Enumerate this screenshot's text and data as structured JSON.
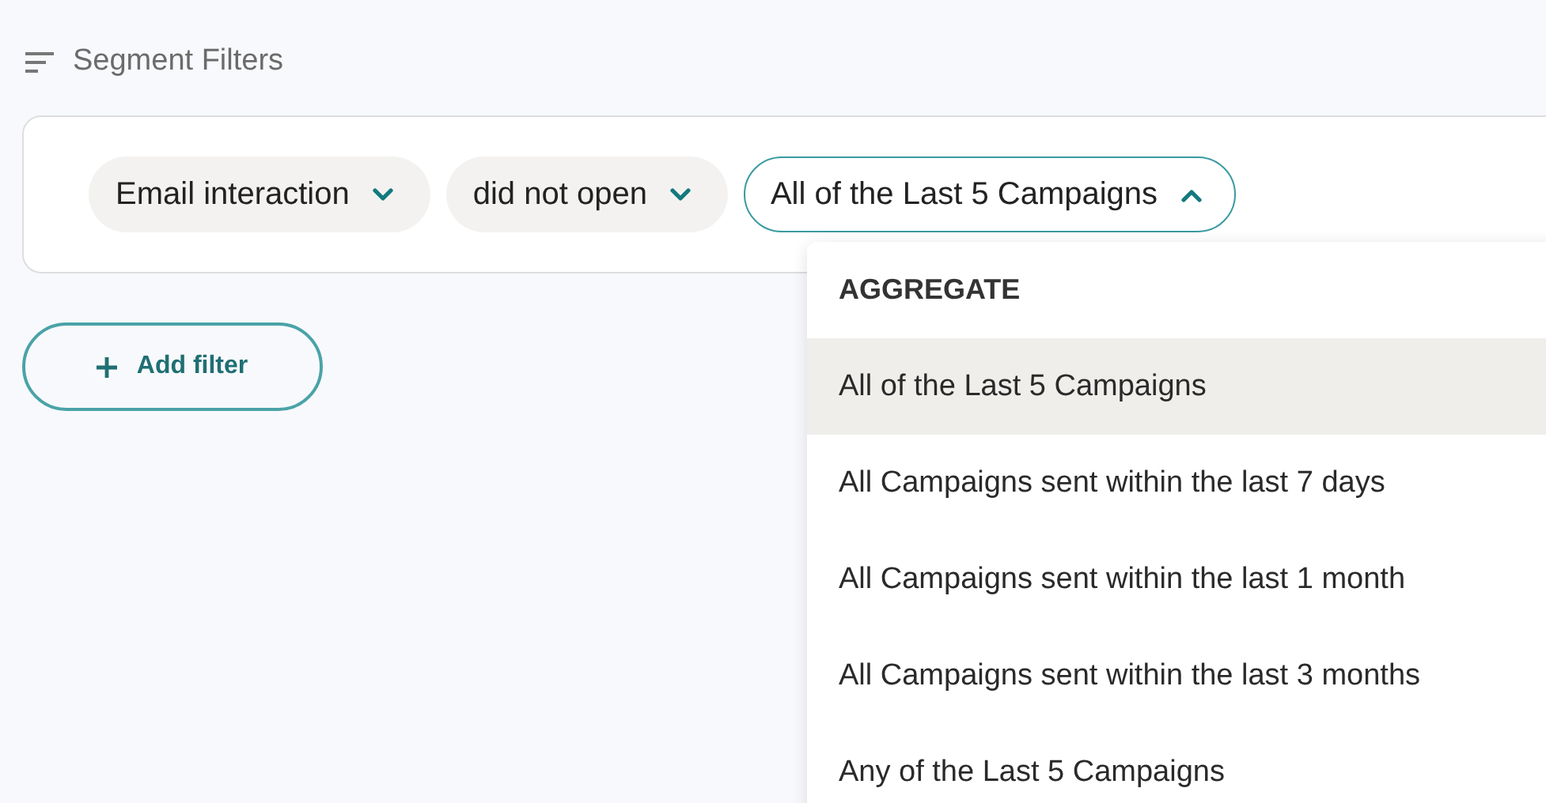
{
  "section": {
    "title": "Segment Filters"
  },
  "filter_chips": [
    {
      "label": "Email interaction",
      "expanded": false
    },
    {
      "label": "did not open",
      "expanded": false
    },
    {
      "label": "All of the Last 5 Campaigns",
      "expanded": true
    }
  ],
  "add_button": {
    "label": "Add filter"
  },
  "dropdown": {
    "group_heading": "AGGREGATE",
    "options": [
      {
        "label": "All of the Last 5 Campaigns",
        "selected": true
      },
      {
        "label": "All Campaigns sent within the last 7 days",
        "selected": false
      },
      {
        "label": "All Campaigns sent within the last 1 month",
        "selected": false
      },
      {
        "label": "All Campaigns sent within the last 3 months",
        "selected": false
      },
      {
        "label": "Any of the Last 5 Campaigns",
        "selected": false
      }
    ]
  }
}
